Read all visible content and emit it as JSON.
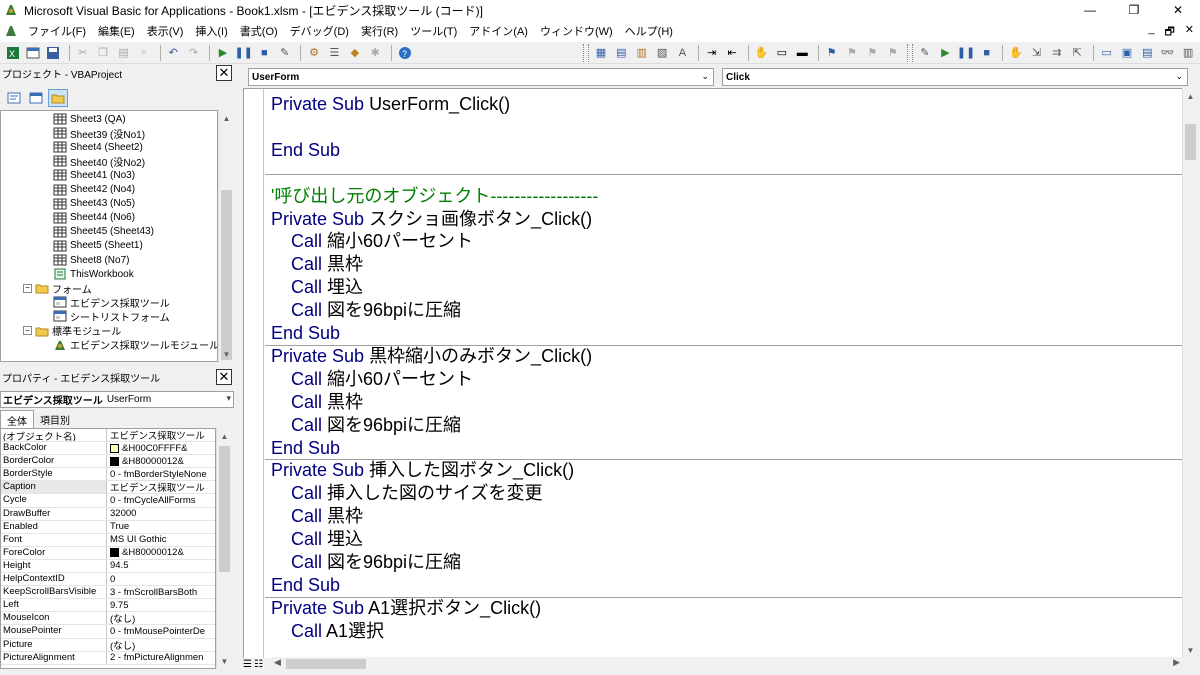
{
  "window": {
    "title": "Microsoft Visual Basic for Applications - Book1.xlsm - [エビデンス採取ツール (コード)]",
    "minimize": "—",
    "restore": "❐",
    "close": "✕"
  },
  "menu": {
    "items": [
      "ファイル(F)",
      "編集(E)",
      "表示(V)",
      "挿入(I)",
      "書式(O)",
      "デバッグ(D)",
      "実行(R)",
      "ツール(T)",
      "アドイン(A)",
      "ウィンドウ(W)",
      "ヘルプ(H)"
    ],
    "mdi_min": "_",
    "mdi_restore": "🗗",
    "mdi_close": "✕"
  },
  "project_panel": {
    "title": "プロジェクト - VBAProject",
    "close": "✕",
    "tree": [
      {
        "label": "Sheet3 (QA)",
        "type": "sheet",
        "indent": 3
      },
      {
        "label": "Sheet39 (没No1)",
        "type": "sheet",
        "indent": 3
      },
      {
        "label": "Sheet4 (Sheet2)",
        "type": "sheet",
        "indent": 3
      },
      {
        "label": "Sheet40 (没No2)",
        "type": "sheet",
        "indent": 3
      },
      {
        "label": "Sheet41 (No3)",
        "type": "sheet",
        "indent": 3
      },
      {
        "label": "Sheet42 (No4)",
        "type": "sheet",
        "indent": 3
      },
      {
        "label": "Sheet43 (No5)",
        "type": "sheet",
        "indent": 3
      },
      {
        "label": "Sheet44 (No6)",
        "type": "sheet",
        "indent": 3
      },
      {
        "label": "Sheet45 (Sheet43)",
        "type": "sheet",
        "indent": 3
      },
      {
        "label": "Sheet5 (Sheet1)",
        "type": "sheet",
        "indent": 3
      },
      {
        "label": "Sheet8 (No7)",
        "type": "sheet",
        "indent": 3
      },
      {
        "label": "ThisWorkbook",
        "type": "workbook",
        "indent": 3
      },
      {
        "label": "フォーム",
        "type": "folder",
        "indent": 1
      },
      {
        "label": "エビデンス採取ツール",
        "type": "form",
        "indent": 3
      },
      {
        "label": "シートリストフォーム",
        "type": "form",
        "indent": 3
      },
      {
        "label": "標準モジュール",
        "type": "folder",
        "indent": 1
      },
      {
        "label": "エビデンス採取ツールモジュール",
        "type": "module",
        "indent": 3
      }
    ]
  },
  "properties_panel": {
    "title": "プロパティ - エビデンス採取ツール",
    "close": "✕",
    "object_name": "エビデンス採取ツール",
    "object_type": "UserForm",
    "tabs": [
      "全体",
      "項目別"
    ],
    "rows": [
      {
        "name": "(オブジェクト名)",
        "value": "エビデンス採取ツール",
        "swatch": null
      },
      {
        "name": "BackColor",
        "value": "&H00C0FFFF&",
        "swatch": "#ffffc0"
      },
      {
        "name": "BorderColor",
        "value": "&H80000012&",
        "swatch": "#000000"
      },
      {
        "name": "BorderStyle",
        "value": "0 - fmBorderStyleNone",
        "swatch": null
      },
      {
        "name": "Caption",
        "value": "エビデンス採取ツール",
        "swatch": null
      },
      {
        "name": "Cycle",
        "value": "0 - fmCycleAllForms",
        "swatch": null
      },
      {
        "name": "DrawBuffer",
        "value": "32000",
        "swatch": null
      },
      {
        "name": "Enabled",
        "value": "True",
        "swatch": null
      },
      {
        "name": "Font",
        "value": "MS UI Gothic",
        "swatch": null
      },
      {
        "name": "ForeColor",
        "value": "&H80000012&",
        "swatch": "#000000"
      },
      {
        "name": "Height",
        "value": "94.5",
        "swatch": null
      },
      {
        "name": "HelpContextID",
        "value": "0",
        "swatch": null
      },
      {
        "name": "KeepScrollBarsVisible",
        "value": "3 - fmScrollBarsBoth",
        "swatch": null
      },
      {
        "name": "Left",
        "value": "9.75",
        "swatch": null
      },
      {
        "name": "MouseIcon",
        "value": "(なし)",
        "swatch": null
      },
      {
        "name": "MousePointer",
        "value": "0 - fmMousePointerDe",
        "swatch": null
      },
      {
        "name": "Picture",
        "value": "(なし)",
        "swatch": null
      },
      {
        "name": "PictureAlignment",
        "value": "2 - fmPictureAlignmen",
        "swatch": null
      }
    ]
  },
  "code_window": {
    "object_combo": "UserForm",
    "procedure_combo": "Click",
    "lines": [
      {
        "kw": "Private Sub ",
        "rest": "UserForm_Click()",
        "type": "code"
      },
      {
        "kw": "",
        "rest": "",
        "type": "blank"
      },
      {
        "kw": "End Sub",
        "rest": "",
        "type": "code"
      },
      {
        "kw": "",
        "rest": "",
        "type": "sep"
      },
      {
        "kw": "",
        "rest": "'呼び出し元のオブジェクト------------------",
        "type": "comment"
      },
      {
        "kw": "Private Sub ",
        "rest": "スクショ画像ボタン_Click()",
        "type": "code"
      },
      {
        "kw": "    Call ",
        "rest": "縮小60パーセント",
        "type": "code"
      },
      {
        "kw": "    Call ",
        "rest": "黒枠",
        "type": "code"
      },
      {
        "kw": "    Call ",
        "rest": "埋込",
        "type": "code"
      },
      {
        "kw": "    Call ",
        "rest": "図を96bpiに圧縮",
        "type": "code"
      },
      {
        "kw": "End Sub",
        "rest": "",
        "type": "code"
      },
      {
        "kw": "Private Sub ",
        "rest": "黒枠縮小のみボタン_Click()",
        "type": "code"
      },
      {
        "kw": "    Call ",
        "rest": "縮小60パーセント",
        "type": "code"
      },
      {
        "kw": "    Call ",
        "rest": "黒枠",
        "type": "code"
      },
      {
        "kw": "    Call ",
        "rest": "図を96bpiに圧縮",
        "type": "code"
      },
      {
        "kw": "End Sub",
        "rest": "",
        "type": "code"
      },
      {
        "kw": "Private Sub ",
        "rest": "挿入した図ボタン_Click()",
        "type": "code"
      },
      {
        "kw": "    Call ",
        "rest": "挿入した図のサイズを変更",
        "type": "code"
      },
      {
        "kw": "    Call ",
        "rest": "黒枠",
        "type": "code"
      },
      {
        "kw": "    Call ",
        "rest": "埋込",
        "type": "code"
      },
      {
        "kw": "    Call ",
        "rest": "図を96bpiに圧縮",
        "type": "code"
      },
      {
        "kw": "End Sub",
        "rest": "",
        "type": "code"
      },
      {
        "kw": "Private Sub ",
        "rest": "A1選択ボタン_Click()",
        "type": "code"
      },
      {
        "kw": "    Call ",
        "rest": "A1選択",
        "type": "code"
      }
    ]
  },
  "colors": {
    "keyword": "#00007f",
    "comment": "#007f00",
    "text": "#000000"
  }
}
